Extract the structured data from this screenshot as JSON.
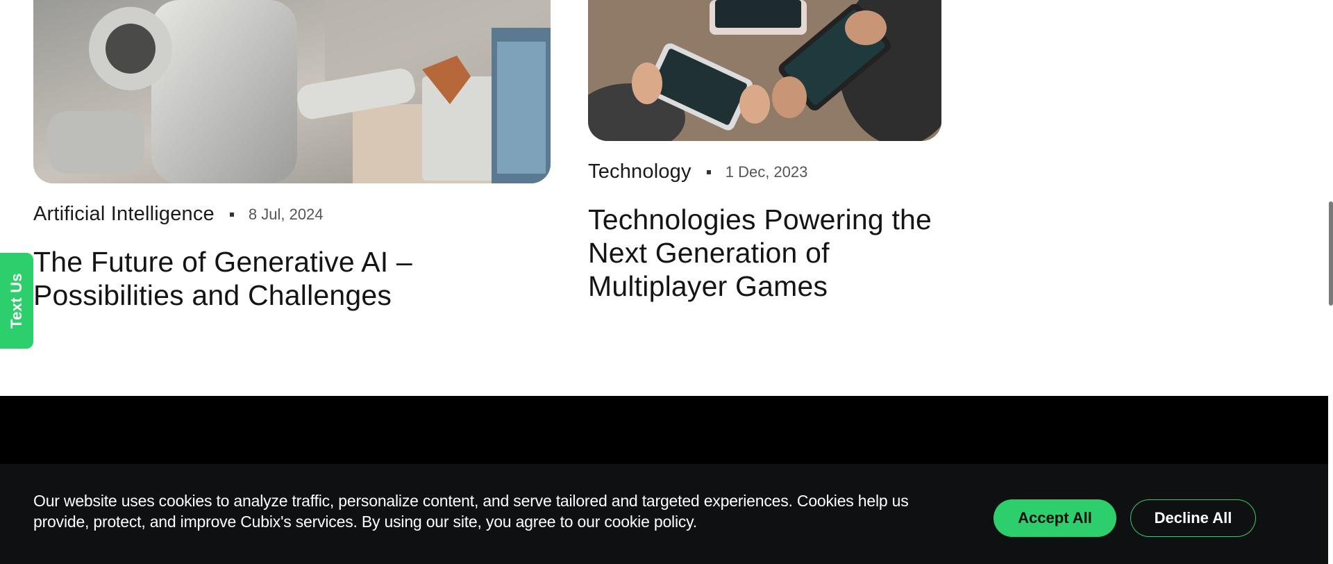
{
  "posts": [
    {
      "category": "Artificial Intelligence",
      "date": "8 Jul, 2024",
      "title": "The Future of Generative AI – Possibilities and Challenges",
      "image_icon": "robot-image"
    },
    {
      "category": "Technology",
      "date": "1 Dec, 2023",
      "title": "Technologies Powering the Next Generation of Multiplayer Games",
      "image_icon": "mobile-gaming-image"
    }
  ],
  "text_us": {
    "label": "Text Us"
  },
  "cookie_banner": {
    "message": "Our website uses cookies to analyze traffic, personalize content, and serve tailored and targeted experiences. Cookies help us provide, protect, and improve Cubix's services. By using our site, you agree to our cookie policy.",
    "accept_label": "Accept All",
    "decline_label": "Decline All"
  },
  "colors": {
    "accent": "#2ccf6b",
    "footer": "#000000",
    "banner": "#0f1011"
  }
}
